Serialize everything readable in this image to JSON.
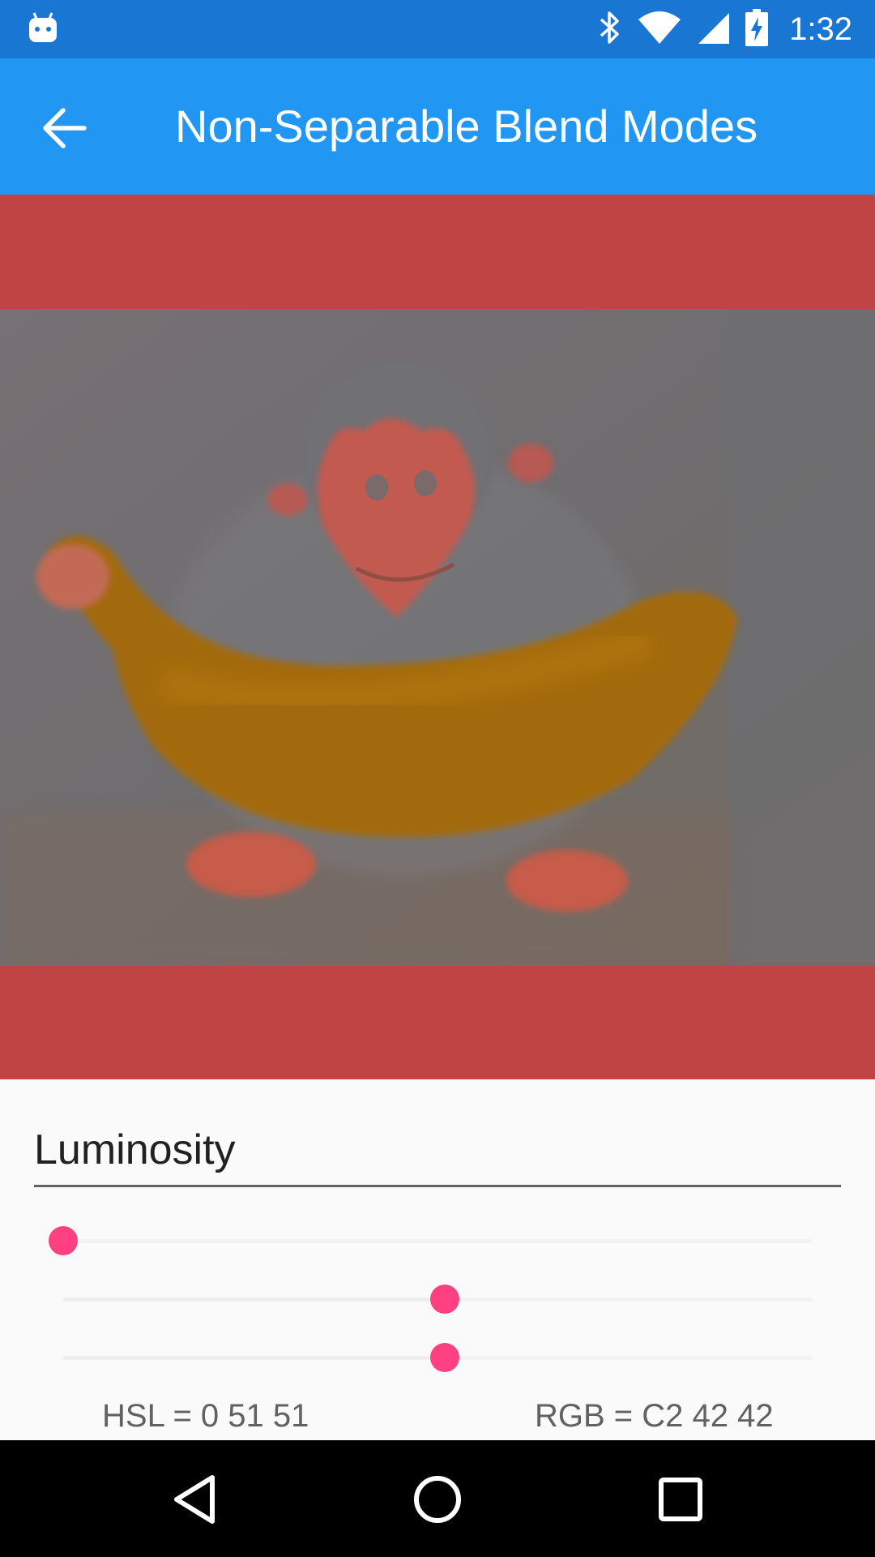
{
  "status_bar": {
    "time": "1:32",
    "icons": [
      "android-icon",
      "bluetooth-icon",
      "wifi-icon",
      "cell-signal-icon",
      "battery-charging-icon"
    ]
  },
  "app_bar": {
    "title": "Non-Separable Blend Modes",
    "back_icon": "arrow-back-icon"
  },
  "blend": {
    "blend_color": "#c04444",
    "image_subject": "monkey-holding-banana-photo"
  },
  "controls": {
    "mode": "Luminosity",
    "sliders": [
      {
        "name": "hue",
        "value": 0
      },
      {
        "name": "saturation",
        "value": 0.51
      },
      {
        "name": "lightness",
        "value": 0.51
      }
    ],
    "hsl_text": "HSL = 0 51 51",
    "rgb_text": "RGB = C2 42 42",
    "accent_color": "#ff4081"
  },
  "nav_bar": {
    "icons": [
      "back-triangle-icon",
      "home-circle-icon",
      "recents-square-icon"
    ]
  }
}
